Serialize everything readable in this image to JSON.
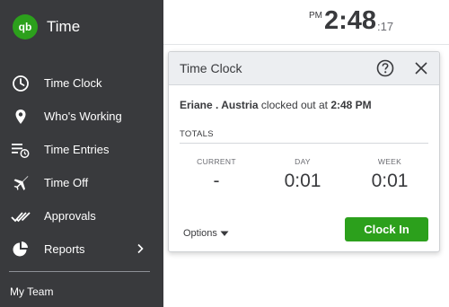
{
  "brand": {
    "logo_text": "qb",
    "title": "Time"
  },
  "sidebar": {
    "items": [
      {
        "label": "Time Clock",
        "icon": "clock-icon"
      },
      {
        "label": "Who's Working",
        "icon": "location-pin-icon"
      },
      {
        "label": "Time Entries",
        "icon": "time-entries-icon"
      },
      {
        "label": "Time Off",
        "icon": "airplane-icon"
      },
      {
        "label": "Approvals",
        "icon": "approvals-checkmark-icon"
      },
      {
        "label": "Reports",
        "icon": "pie-chart-icon",
        "has_submenu": true
      }
    ],
    "team_label": "My Team"
  },
  "clock": {
    "ampm": "PM",
    "hours_minutes": "2:48",
    "seconds": ":17"
  },
  "popup": {
    "title": "Time Clock",
    "status": {
      "name": "Eriane . Austria",
      "text": " clocked out at ",
      "time": "2:48 PM"
    },
    "totals_label": "TOTALS",
    "columns": [
      {
        "label": "CURRENT",
        "value": "-"
      },
      {
        "label": "DAY",
        "value": "0:01"
      },
      {
        "label": "WEEK",
        "value": "0:01"
      }
    ],
    "options_label": "Options",
    "clock_in_label": "Clock In"
  },
  "colors": {
    "sidebar_bg": "#393a3d",
    "brand_green": "#2ca01c",
    "text_dark": "#393a3d",
    "header_bg": "#eceef1"
  }
}
